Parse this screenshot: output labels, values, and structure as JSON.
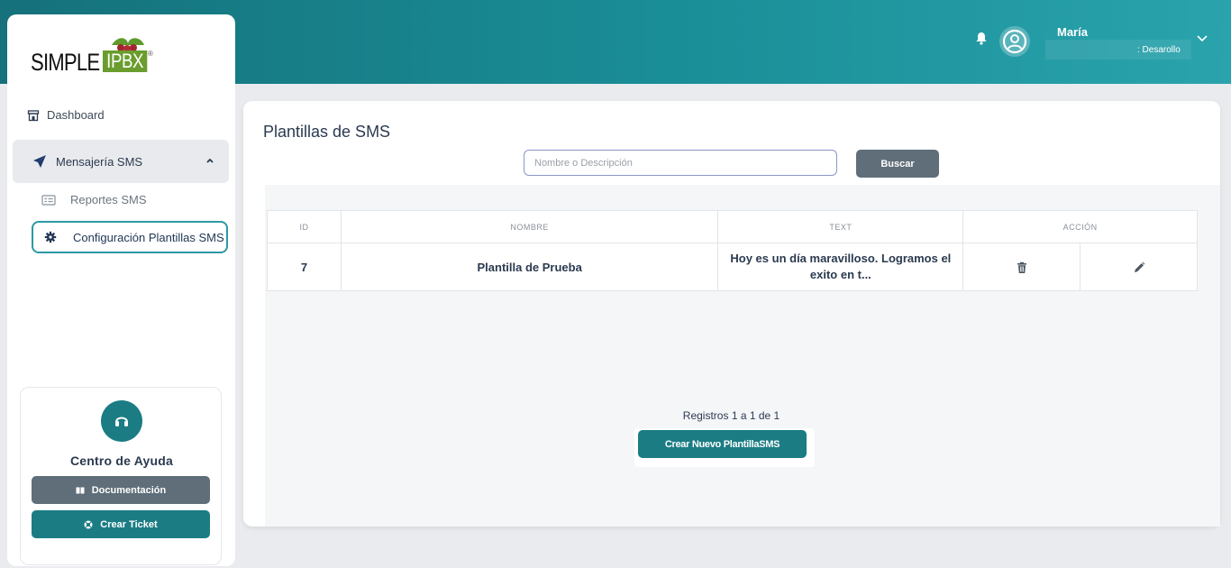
{
  "app": {
    "logo_text_1": "SIMPLE",
    "logo_text_2": "IPBX",
    "logo_reg": "®"
  },
  "header": {
    "user_name": "María",
    "user_dept": ": Desarollo"
  },
  "sidebar": {
    "items": [
      {
        "label": "Dashboard"
      },
      {
        "label": "Mensajería SMS"
      },
      {
        "label": "Reportes SMS"
      },
      {
        "label": "Configuración Plantillas SMS"
      }
    ],
    "help": {
      "title": "Centro de Ayuda",
      "doc_label": "Documentación",
      "ticket_label": "Crear Ticket"
    }
  },
  "main": {
    "title": "Plantillas de SMS",
    "search": {
      "placeholder": "Nombre o Descripción",
      "value": "",
      "button_label": "Buscar"
    },
    "table": {
      "headers": [
        "ID",
        "NOMBRE",
        "TEXT",
        "ACCIÓN"
      ],
      "rows": [
        {
          "id": "7",
          "nombre": "Plantilla de Prueba",
          "text": "Hoy es un día maravilloso. Logramos el exito en t..."
        }
      ]
    },
    "registros": "Registros 1 a 1 de 1",
    "create_label": "Crear Nuevo PlantillaSMS"
  },
  "colors": {
    "teal": "#1b7c84",
    "gray_button": "#5f6e79",
    "active_border": "#2b9aa3"
  },
  "icons": {
    "dashboard": "storefront-icon",
    "sms": "paper-plane-icon",
    "reports": "list-card-icon",
    "config": "gear-icon",
    "help": "headset-icon",
    "doc": "book-icon",
    "ticket": "life-ring-icon",
    "bell": "bell-icon",
    "avatar": "user-circle-icon",
    "delete": "trash-icon",
    "edit": "pencil-icon"
  }
}
